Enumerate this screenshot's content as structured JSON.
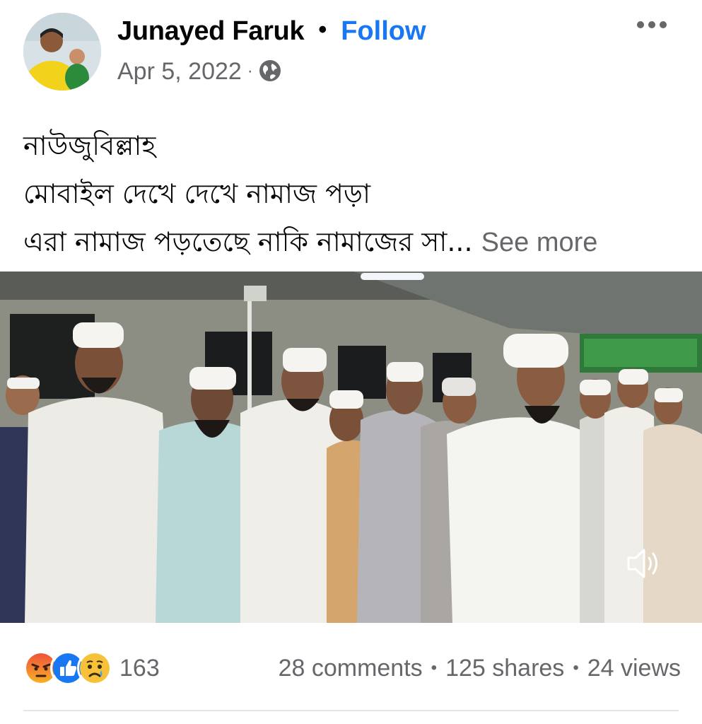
{
  "post": {
    "author": "Junayed Faruk",
    "separator": "•",
    "follow_label": "Follow",
    "date": "Apr 5, 2022",
    "meta_separator": "·",
    "privacy_icon": "globe-icon",
    "menu_icon": "more-options-icon",
    "text_lines": [
      "নাউজুবিল্লাহ",
      "মোবাইল দেখে দেখে নামাজ পড়া",
      "এরা নামাজ পড়তেছে নাকি নামাজের সা..."
    ],
    "see_more_label": "See more"
  },
  "video": {
    "volume_icon": "volume-icon"
  },
  "stats": {
    "reaction_icons": [
      "angry-icon",
      "like-icon",
      "sad-icon"
    ],
    "reaction_count": "163",
    "comments": "28 comments",
    "shares": "125 shares",
    "views": "24 views",
    "separator": "•"
  },
  "colors": {
    "accent": "#1877f2",
    "secondary_text": "#65676b",
    "primary_text": "#050505"
  }
}
